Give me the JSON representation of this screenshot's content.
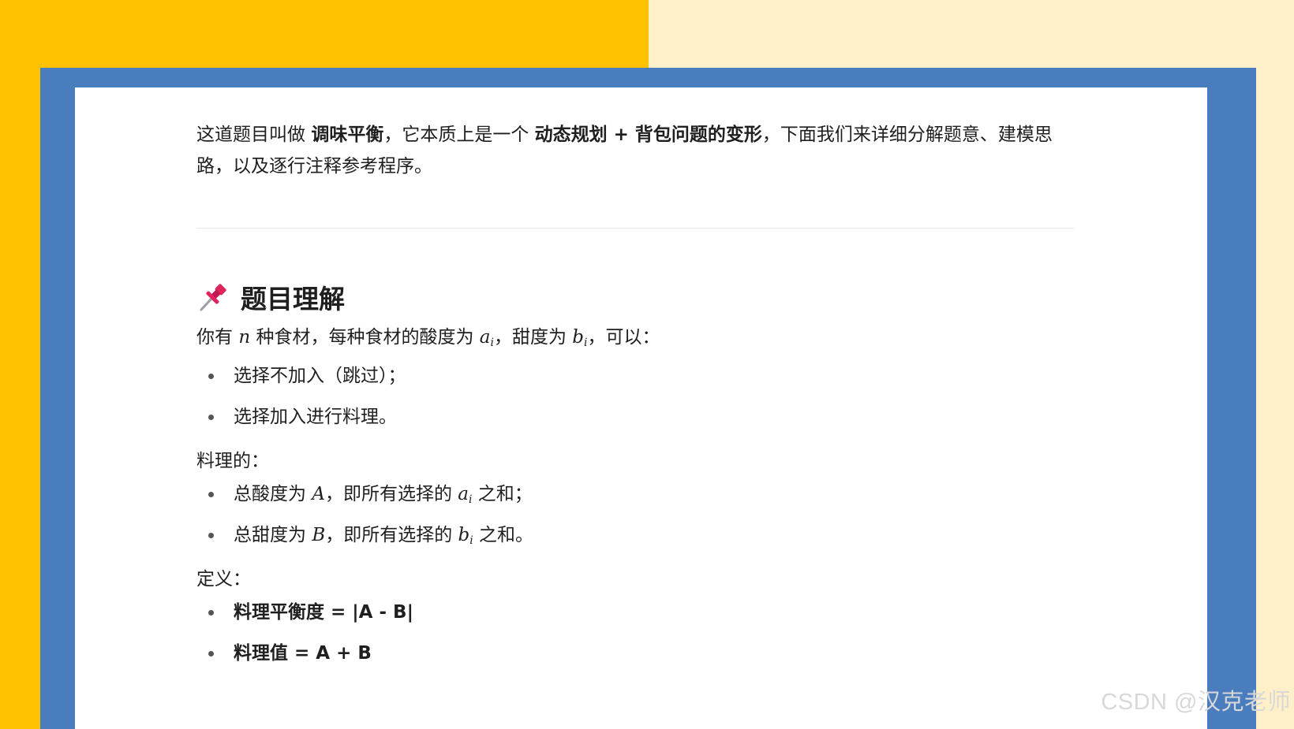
{
  "colors": {
    "left_background": "#FFC100",
    "right_background": "#FFF0C9",
    "frame": "#4A7DBE",
    "paper": "#FFFFFF"
  },
  "intro": {
    "part1": "这道题目叫做 ",
    "bold1": "调味平衡",
    "part2": "，它本质上是一个 ",
    "bold2": "动态规划 + 背包问题的变形",
    "part3": "，下面我们来详细分解题意、建模思路，以及逐行注释参考程序。"
  },
  "section": {
    "icon": "pushpin-icon",
    "title": "题目理解"
  },
  "para1": {
    "t1": "你有 ",
    "v1": "n",
    "t2": " 种食材，每种食材的酸度为 ",
    "v2": "a",
    "s2": "i",
    "t3": "，甜度为 ",
    "v3": "b",
    "s3": "i",
    "t4": "，可以："
  },
  "list1": [
    "选择不加入（跳过）；",
    "选择加入进行料理。"
  ],
  "label2": "料理的：",
  "list2": {
    "item1": {
      "t1": "总酸度为 ",
      "v1": "A",
      "t2": "，即所有选择的 ",
      "v2": "a",
      "s2": "i",
      "t3": " 之和；"
    },
    "item2": {
      "t1": "总甜度为 ",
      "v1": "B",
      "t2": "，即所有选择的 ",
      "v2": "b",
      "s2": "i",
      "t3": " 之和。"
    }
  },
  "label3": "定义：",
  "list3": [
    "料理平衡度 = |A - B|",
    "料理值 = A + B"
  ],
  "watermark": "CSDN @汉克老师"
}
